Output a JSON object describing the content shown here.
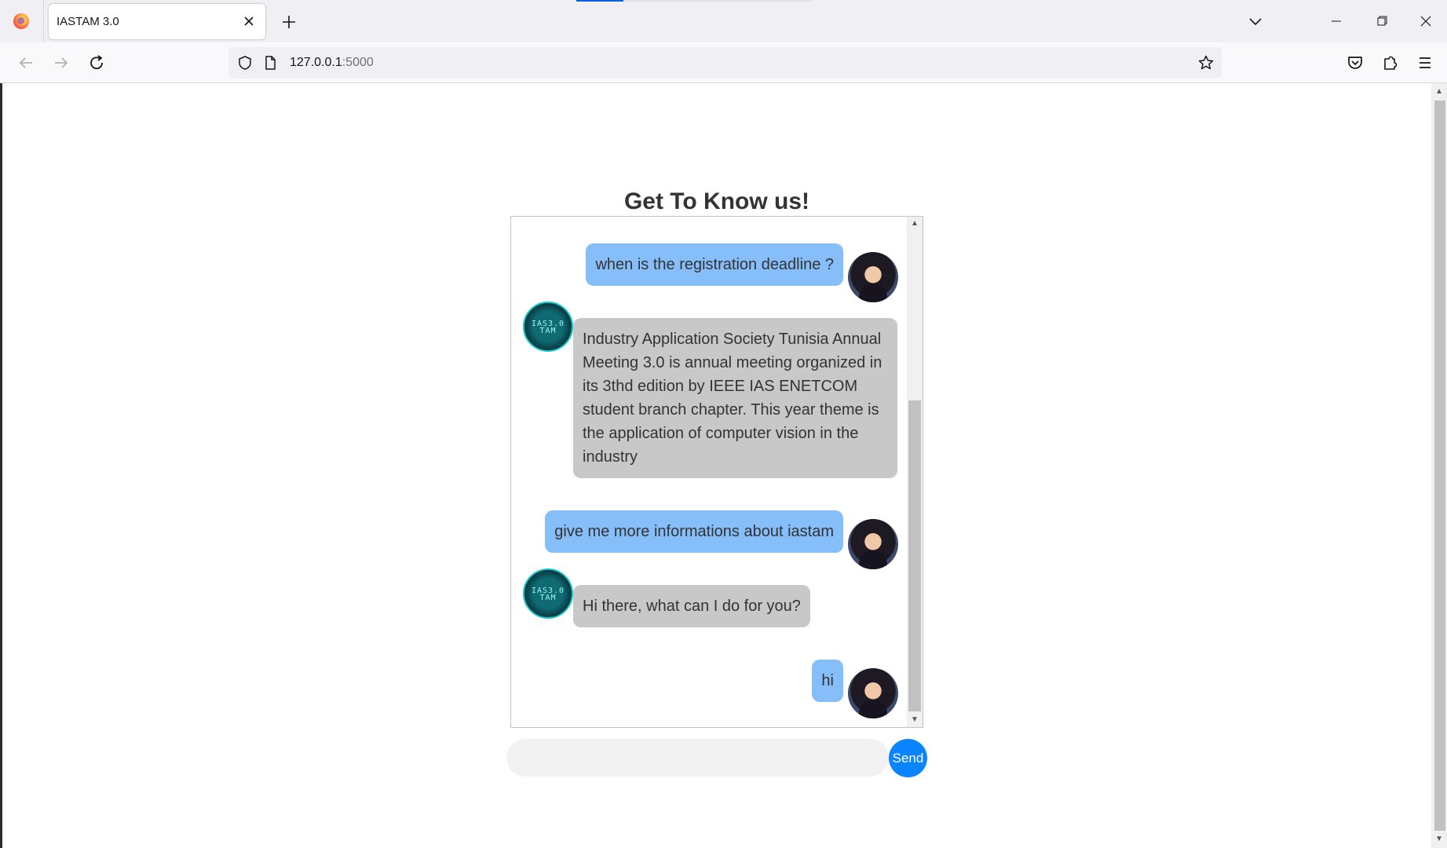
{
  "browser": {
    "tab_title": "IASTAM 3.0",
    "tab_close_icon": "close-icon",
    "new_tab_icon": "plus-icon",
    "url_host": "127.0.0.1",
    "url_port": ":5000",
    "icons": [
      "firefox-icon",
      "back-icon",
      "forward-icon",
      "reload-icon",
      "shield-icon",
      "page-icon",
      "bookmark-star-icon",
      "pocket-icon",
      "extensions-icon",
      "menu-icon",
      "tab-list-icon",
      "minimize-icon",
      "restore-icon",
      "window-close-icon"
    ]
  },
  "page": {
    "heading": "Get To Know us!"
  },
  "chat": {
    "messages": [
      {
        "sender": "user",
        "text": "when is the registration deadline ?"
      },
      {
        "sender": "bot",
        "text": "Industry Application Society Tunisia Annual Meeting 3.0 is annual meeting organized in its 3thd edition by IEEE IAS ENETCOM student branch chapter. This year theme is the application of computer vision in the industry"
      },
      {
        "sender": "user",
        "text": "give me more informations about iastam"
      },
      {
        "sender": "bot",
        "text": "Hi there, what can I do for you?"
      },
      {
        "sender": "user",
        "text": "hi"
      }
    ],
    "bot_logo_text": "IAS3.0 TAM"
  },
  "composer": {
    "input_value": "",
    "input_placeholder": "",
    "send_label": "Send"
  },
  "colors": {
    "user_bubble": "#85bef9",
    "bot_bubble": "#c8c8c8",
    "send_button": "#0a84ff",
    "text": "#333333"
  }
}
